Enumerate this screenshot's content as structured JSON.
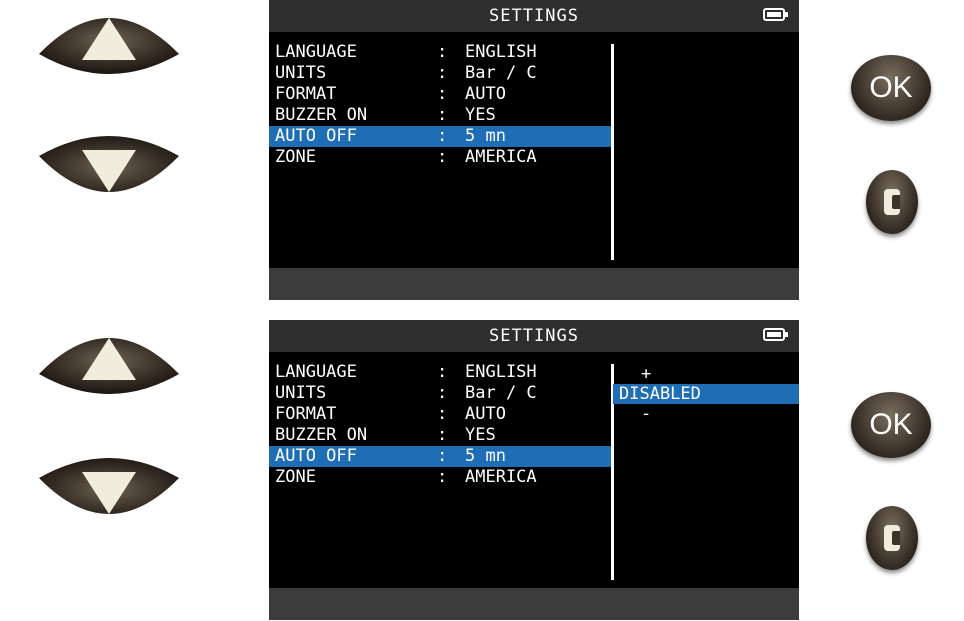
{
  "icons": {
    "up": "up-arrow-icon",
    "down": "down-arrow-icon",
    "ok": "ok-button",
    "clear": "clear-icon",
    "battery": "battery-icon"
  },
  "buttons": {
    "ok_label": "OK"
  },
  "colors": {
    "highlight": "#1f6eb5",
    "screen": "#000000",
    "button": "#3a3128"
  },
  "screen_top": {
    "title": "SETTINGS",
    "rows": [
      {
        "label": "LANGUAGE",
        "colon": ":",
        "value": "ENGLISH"
      },
      {
        "label": "UNITS",
        "colon": ":",
        "value": "Bar / C"
      },
      {
        "label": "FORMAT",
        "colon": ":",
        "value": "AUTO"
      },
      {
        "label": "BUZZER ON",
        "colon": ":",
        "value": "YES"
      },
      {
        "label": "AUTO OFF",
        "colon": ":",
        "value": "5 mn",
        "selected": true
      },
      {
        "label": "ZONE",
        "colon": ":",
        "value": "AMERICA"
      }
    ]
  },
  "screen_bottom": {
    "title": "SETTINGS",
    "rows": [
      {
        "label": "LANGUAGE",
        "colon": ":",
        "value": "ENGLISH"
      },
      {
        "label": "UNITS",
        "colon": ":",
        "value": "Bar / C"
      },
      {
        "label": "FORMAT",
        "colon": ":",
        "value": "AUTO"
      },
      {
        "label": "BUZZER ON",
        "colon": ":",
        "value": "YES"
      },
      {
        "label": "AUTO OFF",
        "colon": ":",
        "value": "5 mn",
        "selected": true
      },
      {
        "label": "ZONE",
        "colon": ":",
        "value": "AMERICA"
      }
    ],
    "options": [
      "+",
      "DISABLED",
      "-"
    ],
    "selected_option": "DISABLED"
  }
}
